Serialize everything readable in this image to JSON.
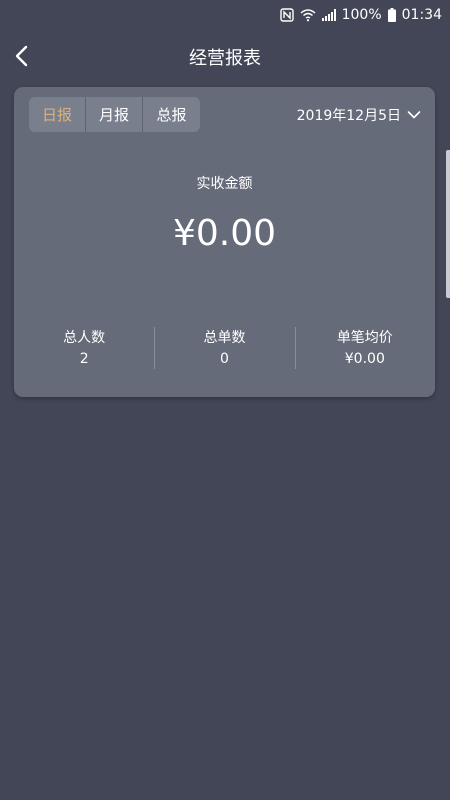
{
  "status_bar": {
    "battery": "100%",
    "time": "01:34"
  },
  "header": {
    "title": "经营报表"
  },
  "card": {
    "tabs": [
      {
        "label": "日报",
        "active": true
      },
      {
        "label": "月报",
        "active": false
      },
      {
        "label": "总报",
        "active": false
      }
    ],
    "date": "2019年12月5日",
    "amount_label": "实收金额",
    "amount_value": "¥0.00",
    "stats": [
      {
        "label": "总人数",
        "value": "2"
      },
      {
        "label": "总单数",
        "value": "0"
      },
      {
        "label": "单笔均价",
        "value": "¥0.00"
      }
    ]
  },
  "colors": {
    "background": "#434656",
    "card": "#666b7a",
    "active_tab": "#d9b27c"
  }
}
